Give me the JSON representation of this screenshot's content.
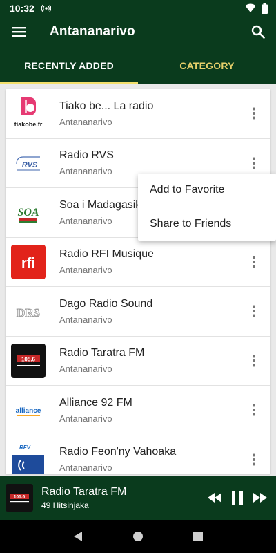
{
  "status_bar": {
    "time": "10:32",
    "icons": [
      "radio-icon",
      "wifi-icon",
      "battery-icon"
    ]
  },
  "app_bar": {
    "title": "Antananarivo",
    "menu_icon": "menu-icon",
    "search_icon": "search-icon"
  },
  "tabs": [
    {
      "label": "RECENTLY ADDED",
      "active": true
    },
    {
      "label": "CATEGORY",
      "active": false
    }
  ],
  "stations": [
    {
      "name": "Tiako be... La radio",
      "city": "Antananarivo",
      "logo_text": "tiakobe.fr"
    },
    {
      "name": "Radio RVS",
      "city": "Antananarivo",
      "logo_text": "RVS"
    },
    {
      "name": "Soa i Madagasikara",
      "city": "Antananarivo",
      "logo_text": "SOA"
    },
    {
      "name": "Radio RFI Musique",
      "city": "Antananarivo",
      "logo_text": "rfi"
    },
    {
      "name": "Dago Radio Sound",
      "city": "Antananarivo",
      "logo_text": "DRS"
    },
    {
      "name": "Radio Taratra FM",
      "city": "Antananarivo",
      "logo_text": "105.6"
    },
    {
      "name": "Alliance 92 FM",
      "city": "Antananarivo",
      "logo_text": "alliance"
    },
    {
      "name": "Radio Feon'ny Vahoaka",
      "city": "Antananarivo",
      "logo_text": "RFV"
    }
  ],
  "context_menu": {
    "items": [
      "Add to Favorite",
      "Share to Friends"
    ]
  },
  "player": {
    "title": "Radio Taratra FM",
    "subtitle": "49 Hitsinjaka",
    "thumb_text": "105.6"
  },
  "colors": {
    "primary": "#0a3b1d",
    "accent": "#f2df6b",
    "tab_inactive": "#e6cf6a"
  }
}
